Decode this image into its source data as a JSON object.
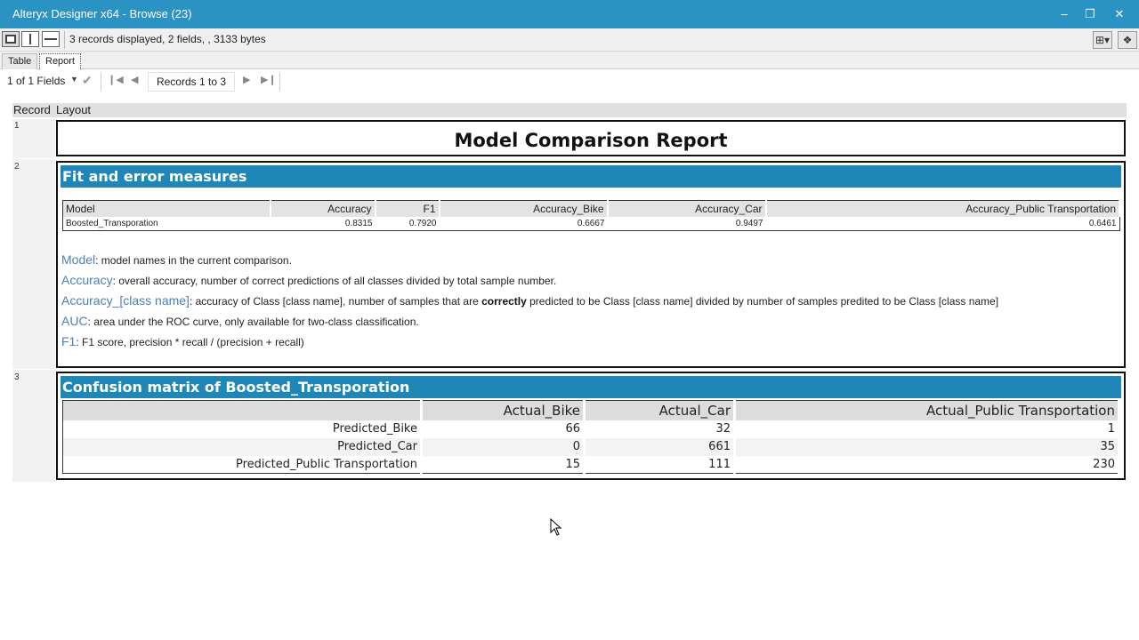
{
  "window": {
    "title": "Alteryx Designer x64 - Browse (23)"
  },
  "toolbar": {
    "status": "3 records displayed, 2 fields, , 3133 bytes"
  },
  "tabs": [
    {
      "label": "Table"
    },
    {
      "label": "Report"
    }
  ],
  "nav": {
    "fields": "1 of 1 Fields",
    "records": "Records 1 to 3"
  },
  "grid": {
    "col_record": "Record",
    "col_layout": "Layout",
    "rows": [
      "1",
      "2",
      "3"
    ]
  },
  "report": {
    "title": "Model Comparison Report",
    "fit_section": {
      "heading": "Fit and error measures",
      "columns": [
        "Model",
        "Accuracy",
        "F1",
        "Accuracy_Bike",
        "Accuracy_Car",
        "Accuracy_Public Transportation"
      ],
      "row": [
        "Boosted_Transporation",
        "0.8315",
        "0.7920",
        "0.6667",
        "0.9497",
        "0.6461"
      ]
    },
    "definitions": [
      {
        "term": "Model",
        "text": ": model names in the current comparison."
      },
      {
        "term": "Accuracy",
        "text": ": overall accuracy, number of correct predictions of all classes divided by total sample number."
      },
      {
        "term": "Accuracy_[class name]",
        "text_before": ": accuracy of Class [class name], number of samples that are ",
        "bold": "correctly",
        "text_after": " predicted to be Class [class name] divided by number of samples predited to be Class [class name]"
      },
      {
        "term": "AUC",
        "text": ": area under the ROC curve, only available for two-class classification."
      },
      {
        "term": "F1",
        "text": ": F1 score, precision * recall / (precision + recall)"
      }
    ],
    "confusion_section": {
      "heading": "Confusion matrix of Boosted_Transporation",
      "columns": [
        "",
        "Actual_Bike",
        "Actual_Car",
        "Actual_Public Transportation"
      ],
      "rows": [
        [
          "Predicted_Bike",
          "66",
          "32",
          "1"
        ],
        [
          "Predicted_Car",
          "0",
          "661",
          "35"
        ],
        [
          "Predicted_Public Transportation",
          "15",
          "111",
          "230"
        ]
      ]
    }
  }
}
